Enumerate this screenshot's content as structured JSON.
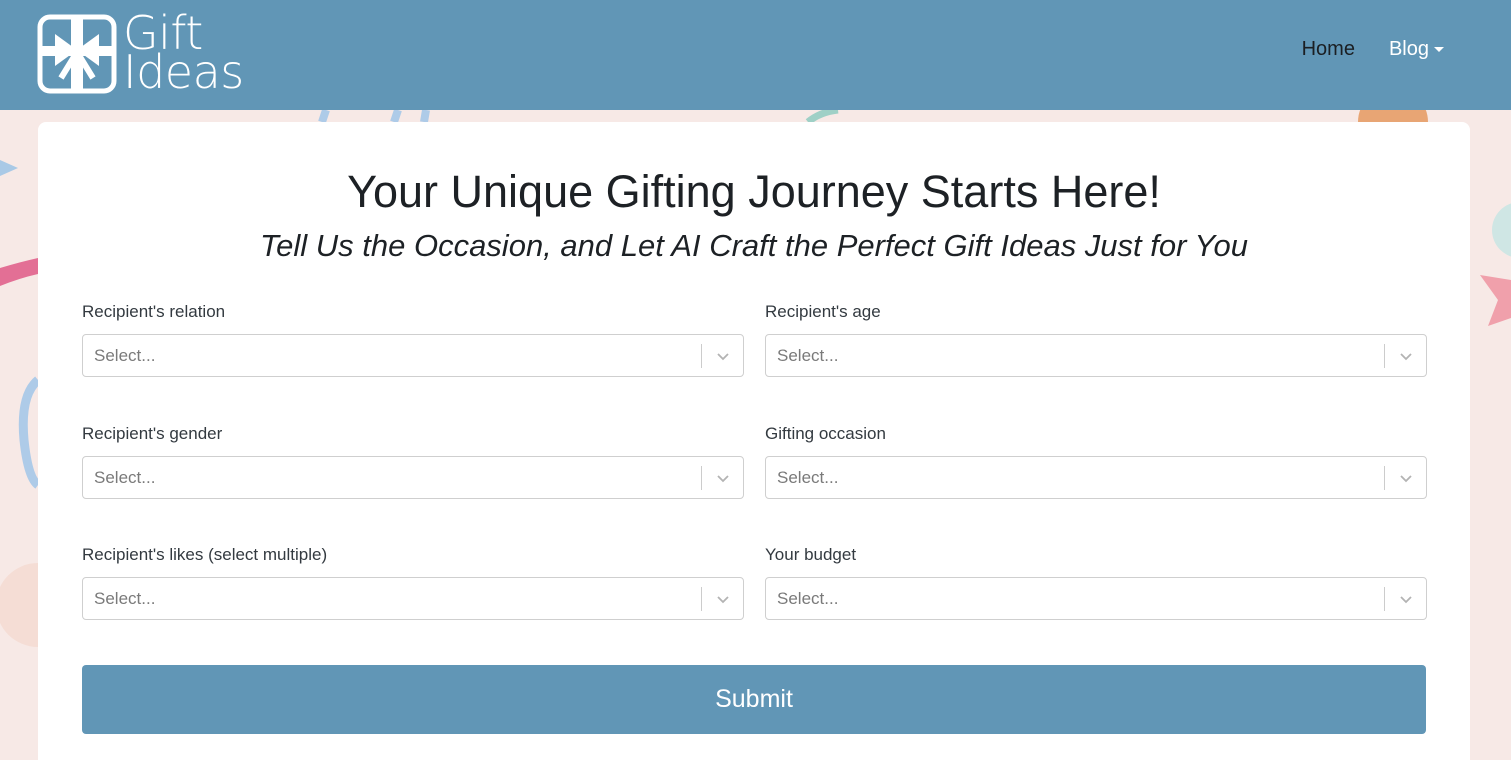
{
  "colors": {
    "navbar": "#6196b6",
    "page_background": "#f7e9e6",
    "card": "#ffffff",
    "submit_button": "#6196b6"
  },
  "header": {
    "logo": {
      "icon": "gift-box-icon",
      "line1": "Gift",
      "line2": "Ideas"
    },
    "nav": {
      "home": "Home",
      "blog": "Blog"
    }
  },
  "main": {
    "title": "Your Unique Gifting Journey Starts Here!",
    "subtitle": "Tell Us the Occasion, and Let AI Craft the Perfect Gift Ideas Just for You",
    "fields": [
      {
        "label": "Recipient's relation",
        "placeholder": "Select..."
      },
      {
        "label": "Recipient's age",
        "placeholder": "Select..."
      },
      {
        "label": "Recipient's gender",
        "placeholder": "Select..."
      },
      {
        "label": "Gifting occasion",
        "placeholder": "Select..."
      },
      {
        "label": "Recipient's likes (select multiple)",
        "placeholder": "Select..."
      },
      {
        "label": "Your budget",
        "placeholder": "Select..."
      }
    ],
    "submit_label": "Submit"
  }
}
